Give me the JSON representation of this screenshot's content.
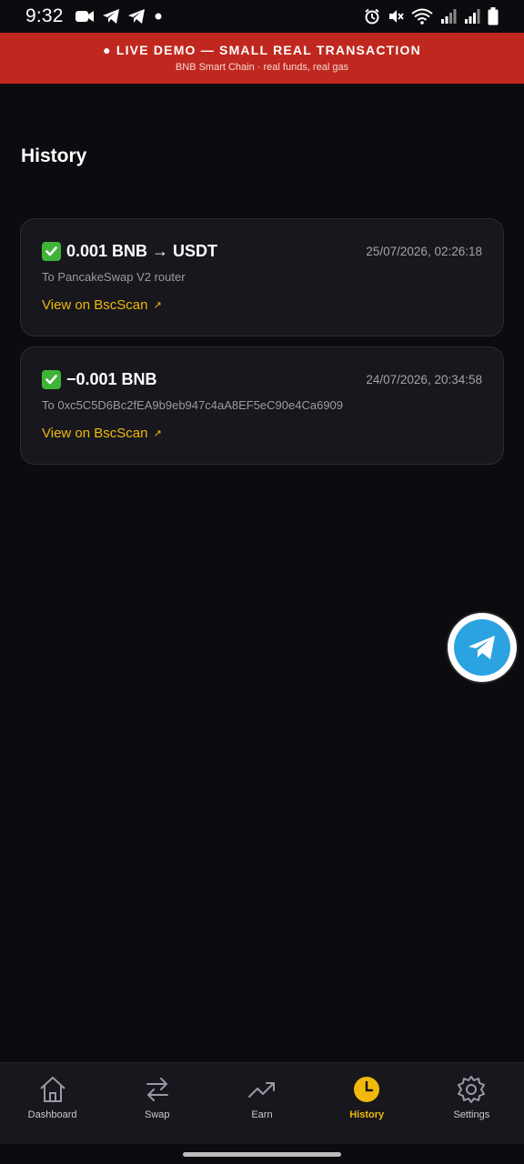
{
  "status_bar": {
    "time": "9:32",
    "left_icons": [
      "video-icon",
      "telegram-icon",
      "telegram-icon",
      "dot-icon"
    ],
    "right_icons": [
      "alarm-icon",
      "mute-icon",
      "wifi-icon",
      "signal-icon",
      "signal-icon",
      "battery-icon"
    ]
  },
  "banner": {
    "title": "● LIVE DEMO — SMALL REAL TRANSACTION",
    "subtitle": "BNB Smart Chain · real funds, real gas",
    "color": "#c0281f"
  },
  "page": {
    "title": "History"
  },
  "transactions": [
    {
      "status_icon": "check-icon",
      "amount": "0.001 BNB → USDT",
      "date": "25/07/2026, 02:26:18",
      "to": "To PancakeSwap V2 router",
      "link": "View on BscScan",
      "link_arrow": "↗"
    },
    {
      "status_icon": "check-icon",
      "amount": "−0.001 BNB",
      "date": "24/07/2026, 20:34:58",
      "to": "To 0xc5C5D6Bc2fEA9b9eb947c4aA8EF5eC90e4Ca6909",
      "link": "View on BscScan",
      "link_arrow": "↗"
    }
  ],
  "fab": {
    "icon": "telegram-icon"
  },
  "nav": {
    "accent": "#f0b90b",
    "items": [
      {
        "label": "Dashboard",
        "icon": "home-icon",
        "active": false
      },
      {
        "label": "Swap",
        "icon": "swap-icon",
        "active": false
      },
      {
        "label": "Earn",
        "icon": "trend-icon",
        "active": false
      },
      {
        "label": "History",
        "icon": "clock-icon",
        "active": true
      },
      {
        "label": "Settings",
        "icon": "gear-icon",
        "active": false
      }
    ]
  }
}
